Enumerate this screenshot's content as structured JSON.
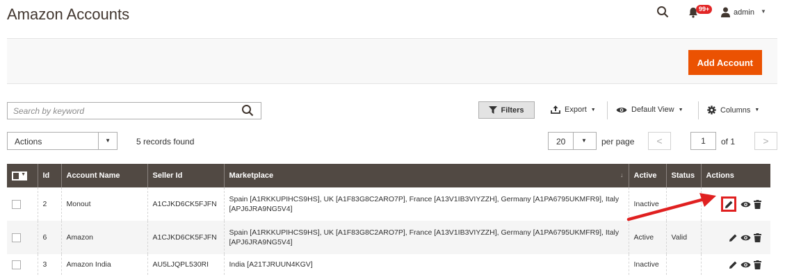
{
  "header": {
    "title": "Amazon Accounts",
    "notifications_badge": "99+",
    "user_name": "admin"
  },
  "action_bar": {
    "add_account_label": "Add Account"
  },
  "toolbar": {
    "search_placeholder": "Search by keyword",
    "filters_label": "Filters",
    "export_label": "Export",
    "default_view_label": "Default View",
    "columns_label": "Columns"
  },
  "controls": {
    "actions_label": "Actions",
    "records_found": "5 records found",
    "per_page_value": "20",
    "per_page_label": "per page",
    "page_number": "1",
    "page_total": "of 1"
  },
  "table": {
    "columns": [
      "Id",
      "Account Name",
      "Seller Id",
      "Marketplace",
      "Active",
      "Status",
      "Actions"
    ],
    "rows": [
      {
        "id": "2",
        "account_name": "Monout",
        "seller_id": "A1CJKD6CK5FJFN",
        "marketplace": "Spain [A1RKKUPIHCS9HS], UK [A1F83G8C2ARO7P], France [A13V1IB3VIYZZH], Germany [A1PA6795UKMFR9], Italy [APJ6JRA9NG5V4]",
        "active": "Inactive",
        "status": ""
      },
      {
        "id": "6",
        "account_name": "Amazon",
        "seller_id": "A1CJKD6CK5FJFN",
        "marketplace": "Spain [A1RKKUPIHCS9HS], UK [A1F83G8C2ARO7P], France [A13V1IB3VIYZZH], Germany [A1PA6795UKMFR9], Italy [APJ6JRA9NG5V4]",
        "active": "Active",
        "status": "Valid"
      },
      {
        "id": "3",
        "account_name": "Amazon India",
        "seller_id": "AU5LJQPL530RI",
        "marketplace": "India [A21TJRUUN4KGV]",
        "active": "Inactive",
        "status": ""
      }
    ]
  },
  "colors": {
    "accent": "#eb5202",
    "table_header": "#514943",
    "annotation": "#e02020"
  }
}
